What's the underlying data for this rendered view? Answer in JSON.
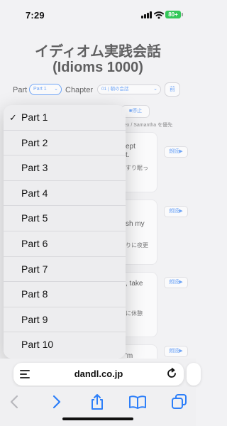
{
  "status": {
    "time": "7:29",
    "battery": "80+"
  },
  "page": {
    "title_line1": "イディオム実践会話",
    "title_line2": "(Idioms 1000)",
    "part_label": "Part",
    "part_value": "Part 1",
    "chapter_label": "Chapter",
    "chapter_value": "01 | 朝の会話",
    "prev_label": "前",
    "stop_label": "■停止",
    "priority_note": "ex / Samantha を優先",
    "cards": [
      {
        "en": "ept",
        "en2": "t.",
        "jp": "すり眠っ",
        "read": "朗読▶"
      },
      {
        "en": "sh my",
        "jp": "りに夜更",
        "read": "朗読▶"
      },
      {
        "en": ", take",
        "jp": "に休憩",
        "read": "朗読▶"
      },
      {
        "en": "'m",
        "read": "朗読▶"
      }
    ]
  },
  "dropdown": {
    "selected": "Part 1",
    "check": "✓",
    "options": [
      "Part 1",
      "Part 2",
      "Part 3",
      "Part 4",
      "Part 5",
      "Part 6",
      "Part 7",
      "Part 8",
      "Part 9",
      "Part 10"
    ]
  },
  "browser": {
    "url": "dandl.co.jp"
  },
  "colors": {
    "accent": "#2d7ff9",
    "battery": "#34c759"
  }
}
